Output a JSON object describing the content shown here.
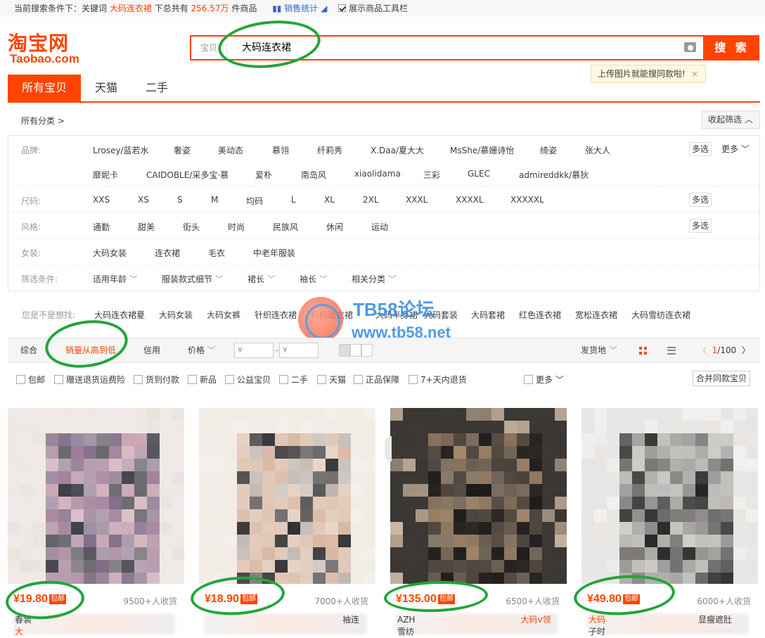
{
  "topbar": {
    "prefix": "当前搜索条件下：关键词",
    "keyword": "大码连衣裙",
    "mid": "下总共有",
    "count": "256.57万",
    "suffix": "件商品",
    "stats_label": "销售统计",
    "toolbar_label": "展示商品工具栏"
  },
  "logo": {
    "cn": "淘宝网",
    "en": "Taobao.com"
  },
  "search": {
    "category": "宝贝",
    "query": "大码连衣裙",
    "button": "搜 索",
    "tip": "上传图片就能搜同款啦!",
    "tip_close": "×"
  },
  "tabs": [
    {
      "label": "所有宝贝",
      "active": true
    },
    {
      "label": "天猫",
      "active": false
    },
    {
      "label": "二手",
      "active": false
    }
  ],
  "categories_label": "所有分类 >",
  "collapse_label": "收起筛选 ︿",
  "filters": {
    "brand": {
      "label": "品牌:",
      "row1": [
        "Lrosey/蓝若水",
        "奢姿",
        "美动态",
        "慕翎",
        "纤莉秀",
        "X.Daa/夏大大",
        "MsShe/慕姗诗怡",
        "绮姿",
        "张大人"
      ],
      "row2": [
        "靡妮卡",
        "CAIDOBLE/采多宝·慕",
        "爱朴",
        "南岛风",
        "xiaolidama",
        "三彩",
        "GLEC",
        "admireddkk/慕狄"
      ],
      "multi": "多选",
      "more": "更多"
    },
    "size": {
      "label": "尺码:",
      "items": [
        "XXS",
        "XS",
        "S",
        "M",
        "均码",
        "L",
        "XL",
        "2XL",
        "XXXL",
        "XXXXL",
        "XXXXXL"
      ],
      "multi": "多选"
    },
    "style": {
      "label": "风格:",
      "items": [
        "通勤",
        "甜美",
        "街头",
        "时尚",
        "民族风",
        "休闲",
        "运动"
      ],
      "multi": "多选"
    },
    "women": {
      "label": "女装:",
      "items": [
        "大码女装",
        "连衣裙",
        "毛衣",
        "中老年服装"
      ]
    },
    "conditions": {
      "label": "筛选条件:",
      "items": [
        "适用年龄",
        "服装款式细节",
        "裙长",
        "袖长",
        "相关分类"
      ]
    }
  },
  "related": {
    "label": "您是不是想找:",
    "items": [
      "大码连衣裙夏",
      "大码女装",
      "大码女裤",
      "针织连衣裙",
      "妈妈连衣裙",
      "大码半身裙",
      "大码套装",
      "大码套裙",
      "红色连衣裙",
      "宽松连衣裙",
      "大码雪纺连衣裙"
    ]
  },
  "watermark": {
    "line1": "TB58论坛",
    "line2": "www.tb58.net"
  },
  "sortbar": {
    "items": [
      "综合",
      "销量从高到低",
      "信用",
      "价格"
    ],
    "active_index": 1,
    "price_min": "¥",
    "price_max": "¥",
    "dash": "-",
    "location": "发货地",
    "page_current": "1",
    "page_total": "/100"
  },
  "checks": {
    "items": [
      "包邮",
      "赠送退货运费险",
      "货到付款",
      "新品",
      "公益宝贝",
      "二手",
      "天猫",
      "正品保障",
      "7+天内退货"
    ],
    "more": "更多",
    "merge": "合并同款宝贝"
  },
  "products": [
    {
      "price": "¥19.80",
      "baoyou": "包邮",
      "sold": "9500+人收货",
      "title_a": "春装",
      "title_b": "大",
      "title_c": "",
      "colors": [
        "#efe9e6",
        "#a07c98",
        "#7e6a86",
        "#3f3f49",
        "#c9a4b3",
        "#e9e3de"
      ]
    },
    {
      "price": "¥18.90",
      "baoyou": "包邮",
      "sold": "7000+人收货",
      "title_a": "",
      "title_b": "",
      "title_c": "袖连",
      "colors": [
        "#f2ece7",
        "#d9b8a3",
        "#2e2e30",
        "#bcb3ad",
        "#e0c6b3",
        "#f4efea"
      ]
    },
    {
      "price": "¥135.00",
      "baoyou": "包邮",
      "sold": "6500+人收货",
      "title_a": "AZH",
      "title_b": "雪纺",
      "title_c": "大码v领",
      "colors": [
        "#3c3834",
        "#a88c6f",
        "#5a4e44",
        "#1f1d1c",
        "#8a7a6a",
        "#cdb9a4"
      ]
    },
    {
      "price": "¥49.80",
      "baoyou": "包邮",
      "sold": "6000+人收货",
      "title_a": "大码",
      "title_b": "子时",
      "title_c": "显瘦遮肚",
      "colors": [
        "#e8e6e4",
        "#9a9896",
        "#1e1e1e",
        "#bdbbb8",
        "#6d6b69",
        "#f2f0ee"
      ]
    }
  ]
}
